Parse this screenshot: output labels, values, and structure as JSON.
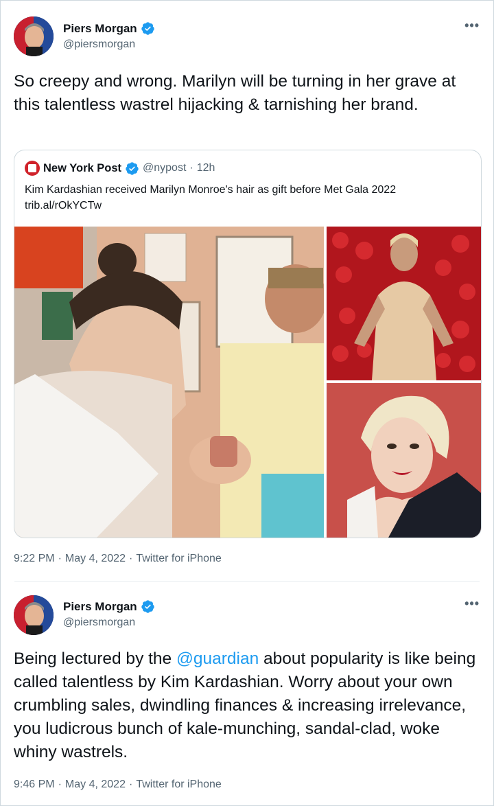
{
  "tweets": [
    {
      "author": {
        "name": "Piers Morgan",
        "handle": "@piersmorgan"
      },
      "text": "So creepy and wrong. Marilyn will be turning in her grave at this talentless wastrel hijacking & tarnishing her brand.",
      "quote": {
        "author": {
          "name": "New York Post",
          "handle": "@nypost",
          "sep": "·",
          "time": "12h"
        },
        "text_line1": "Kim Kardashian received Marilyn Monroe's hair as gift before Met Gala 2022",
        "text_line2": "trib.al/rOkYCTw"
      },
      "time": "9:22 PM",
      "sep1": "·",
      "date": "May 4, 2022",
      "sep2": "·",
      "source": "Twitter for iPhone"
    },
    {
      "author": {
        "name": "Piers Morgan",
        "handle": "@piersmorgan"
      },
      "text_before": "Being lectured by the ",
      "mention": "@guardian",
      "text_after": " about popularity is like being called talentless by Kim Kardashian. Worry about your own crumbling sales, dwindling finances & increasing irrelevance, you ludicrous bunch of kale-munching, sandal-clad, woke whiny wastrels.",
      "time": "9:46 PM",
      "sep1": "·",
      "date": "May 4, 2022",
      "sep2": "·",
      "source": "Twitter for iPhone"
    }
  ],
  "more_label": "•••",
  "icons": {
    "verified": "verified-badge-icon",
    "more": "more-options-icon"
  },
  "colors": {
    "accent": "#1d9bf0",
    "text": "#0f1419",
    "secondary": "#536471",
    "border": "#cfd9de"
  }
}
